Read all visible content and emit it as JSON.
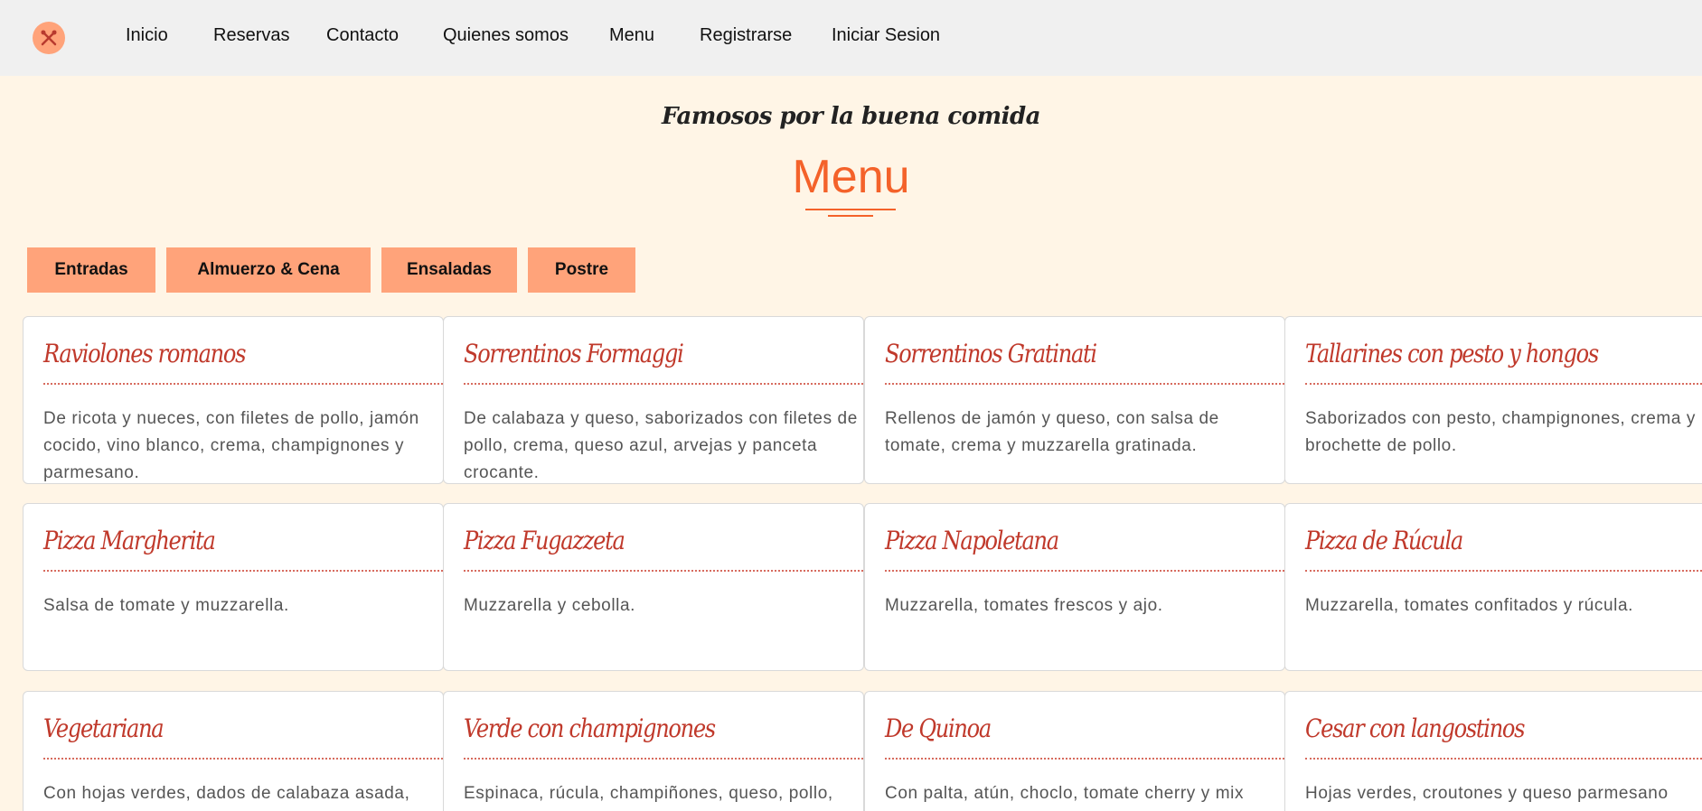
{
  "navbar": {
    "logo_icon": "crossed-fork-knife-icon",
    "links": [
      {
        "label": "Inicio"
      },
      {
        "label": "Reservas"
      },
      {
        "label": "Contacto"
      },
      {
        "label": "Quienes somos"
      },
      {
        "label": "Menu"
      },
      {
        "label": "Registrarse"
      },
      {
        "label": "Iniciar Sesion"
      }
    ]
  },
  "header": {
    "subtitle": "Famosos por la buena comida",
    "title": "Menu"
  },
  "categories": [
    {
      "label": "Entradas"
    },
    {
      "label": "Almuerzo & Cena"
    },
    {
      "label": "Ensaladas"
    },
    {
      "label": "Postre"
    }
  ],
  "menu_items": [
    {
      "title": "Raviolones romanos",
      "description": "De ricota y nueces, con filetes de pollo, jamón cocido, vino blanco, crema, champignones y parmesano."
    },
    {
      "title": "Sorrentinos Formaggi",
      "description": "De calabaza y queso, saborizados con filetes de pollo, crema, queso azul, arvejas y panceta crocante."
    },
    {
      "title": "Sorrentinos Gratinati",
      "description": "Rellenos de jamón y queso, con salsa de tomate, crema y muzzarella gratinada."
    },
    {
      "title": "Tallarines con pesto y hongos",
      "description": "Saborizados con pesto, champignones, crema y brochette de pollo."
    },
    {
      "title": "Pizza Margherita",
      "description": "Salsa de tomate y muzzarella."
    },
    {
      "title": "Pizza Fugazzeta",
      "description": "Muzzarella y cebolla."
    },
    {
      "title": "Pizza Napoletana",
      "description": "Muzzarella, tomates frescos y ajo."
    },
    {
      "title": "Pizza de Rúcula",
      "description": "Muzzarella, tomates confitados y rúcula."
    },
    {
      "title": "Vegetariana",
      "description": "Con hojas verdes, dados de calabaza asada,"
    },
    {
      "title": "Verde con champignones",
      "description": "Espinaca, rúcula, champiñones, queso, pollo,"
    },
    {
      "title": "De Quinoa",
      "description": "Con palta, atún, choclo, tomate cherry y mix"
    },
    {
      "title": "Cesar con langostinos",
      "description": "Hojas verdes, croutones y queso parmesano"
    }
  ],
  "colors": {
    "accent": "#f4622a",
    "button_bg": "#ffa37a",
    "card_title": "#c0392b",
    "page_bg": "#fff5e6"
  }
}
